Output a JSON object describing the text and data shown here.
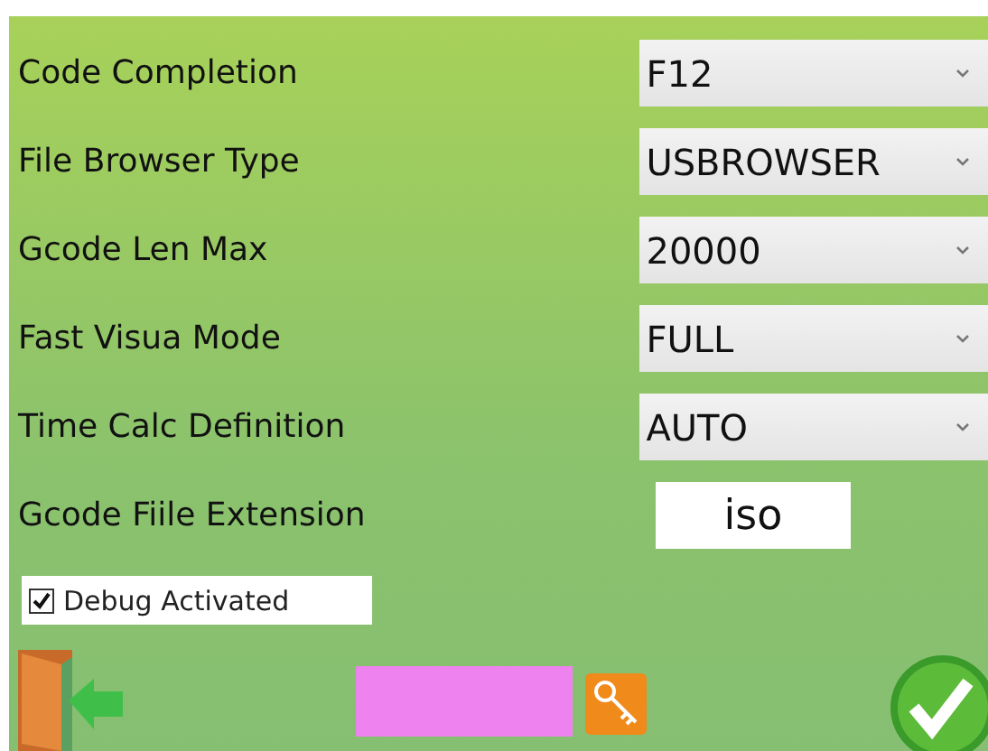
{
  "settings": [
    {
      "label": "Code Completion",
      "kind": "select",
      "value": "F12"
    },
    {
      "label": "File Browser Type",
      "kind": "select",
      "value": "USBROWSER"
    },
    {
      "label": "Gcode Len Max",
      "kind": "select",
      "value": "20000"
    },
    {
      "label": "Fast Visua Mode",
      "kind": "select",
      "value": "FULL"
    },
    {
      "label": "Time Calc Definition",
      "kind": "select",
      "value": "AUTO"
    },
    {
      "label": "Gcode Fiile Extension",
      "kind": "text",
      "value": "iso"
    }
  ],
  "debug": {
    "label": "Debug Activated",
    "checked": true
  }
}
